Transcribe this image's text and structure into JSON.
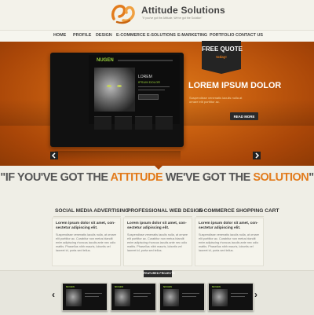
{
  "brand": {
    "name": "Attitude Solutions",
    "tagline": "\"If you've got the Attitude, We've got the Solution\"",
    "accent_color": "#e27b1c"
  },
  "nav": {
    "items": [
      {
        "label": "HOME"
      },
      {
        "label": "PROFILE"
      },
      {
        "label": "DESIGN"
      },
      {
        "label": "E-COMMERCE"
      },
      {
        "label": "E-SOLUTIONS"
      },
      {
        "label": "E-MARKETING"
      },
      {
        "label": "PORTFOLIO"
      },
      {
        "label": "CONTACT US"
      }
    ]
  },
  "quote_badge": {
    "title": "FREE QUOTE",
    "subtitle": "today!"
  },
  "hero": {
    "title": "LOREM IPSUM DOLOR",
    "description": "Suspendisse venenatis iaculis nulla at ornare elit porttitor ac.",
    "button_label": "READ MORE",
    "prev_icon": "chevron-left-icon",
    "next_icon": "chevron-right-icon",
    "screen": {
      "logo": "NUGEN",
      "headline": "LOREM",
      "sub": "IPSUM DOLOR"
    }
  },
  "slogan": {
    "prefix": "\"IF YOU'VE GOT THE ",
    "word1": "ATTITUDE",
    "middle": " WE'VE GOT THE ",
    "word2": "SOLUTION",
    "suffix": "\""
  },
  "columns": [
    {
      "title": "SOCIAL MEDIA ADVERTISING",
      "heading": "Lorem ipsum dolor sit amet, con-sectetur adipiscing elit.",
      "body": "Suspendisse venenatis iaculis nulla, at ornare elit porttitor ac. Curabitur non metus blandit enim adipiscing rhoncus iaculis ante nec odio mattis. Phasellus nibh mauris, lobortis vel laoreet id, porta sed tellus."
    },
    {
      "title": "PROFESSIONAL WEB DESIGN",
      "heading": "Lorem ipsum dolor sit amet, con-sectetur adipiscing elit.",
      "body": "Suspendisse venenatis iaculis nulla, at ornare elit porttitor ac. Curabitur non metus blandit enim adipiscing rhoncus iaculis ante nec odio mattis. Phasellus nibh mauris, lobortis vel laoreet id, porta sed tellus."
    },
    {
      "title": "E-COMMERCE SHOPPING CART",
      "heading": "Lorem ipsum dolor sit amet, con-sectetur adipiscing elit.",
      "body": "Suspendisse venenatis iaculis nulla, at ornare elit porttitor ac. Curabitur non metus blandit enim adipiscing rhoncus iaculis ante nec odio mattis. Phasellus nibh mauris, lobortis vel laoreet id, porta sed tellus."
    }
  ],
  "featured": {
    "label": "FEATURED PROJECTS",
    "prev_glyph": "‹",
    "next_glyph": "›",
    "thumb_logo": "NUGEN"
  }
}
